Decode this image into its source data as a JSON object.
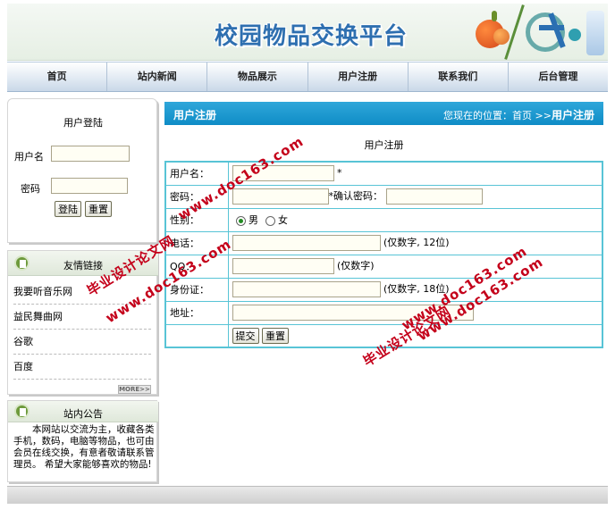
{
  "header": {
    "site_title": "校园物品交换平台"
  },
  "nav": {
    "items": [
      "首页",
      "站内新闻",
      "物品展示",
      "用户注册",
      "联系我们",
      "后台管理"
    ]
  },
  "login": {
    "title": "用户登陆",
    "username_label": "用户名",
    "password_label": "密码",
    "login_button": "登陆",
    "reset_button": "重置"
  },
  "links": {
    "title": "友情链接",
    "items": [
      "我要听音乐网",
      "益民舞曲网",
      "谷歌",
      "百度"
    ],
    "more": "MORE>>"
  },
  "notice": {
    "title": "站内公告",
    "text": "本网站以交流为主，收藏各类手机，数码，电脑等物品，也可由会员在线交换，有意者敬请联系管理员。 希望大家能够喜欢的物品!"
  },
  "main": {
    "bar_title": "用户注册",
    "location_prefix": "您现在的位置：首页 >>",
    "location_current": "用户注册",
    "form_caption": "用户注册"
  },
  "form": {
    "username_label": "用户名：",
    "required_mark": "*",
    "password_label": "密码：",
    "confirm_password_label": "*确认密码：",
    "gender_label": "性别：",
    "gender_male": "男",
    "gender_female": "女",
    "phone_label": "电话：",
    "phone_hint": "(仅数字, 12位)",
    "qq_label": "QQ：",
    "qq_hint": "(仅数字)",
    "id_label": "身份证：",
    "id_hint": "(仅数字, 18位)",
    "address_label": "地址：",
    "submit_button": "提交",
    "reset_button": "重置"
  },
  "watermarks": {
    "lines": [
      "毕业设计论文网",
      "www.doc163.com"
    ]
  },
  "colors": {
    "accent_blue": "#1a98d0",
    "form_border": "#58c4d6",
    "watermark": "#c4001a",
    "title_blue": "#2e6fb0"
  }
}
